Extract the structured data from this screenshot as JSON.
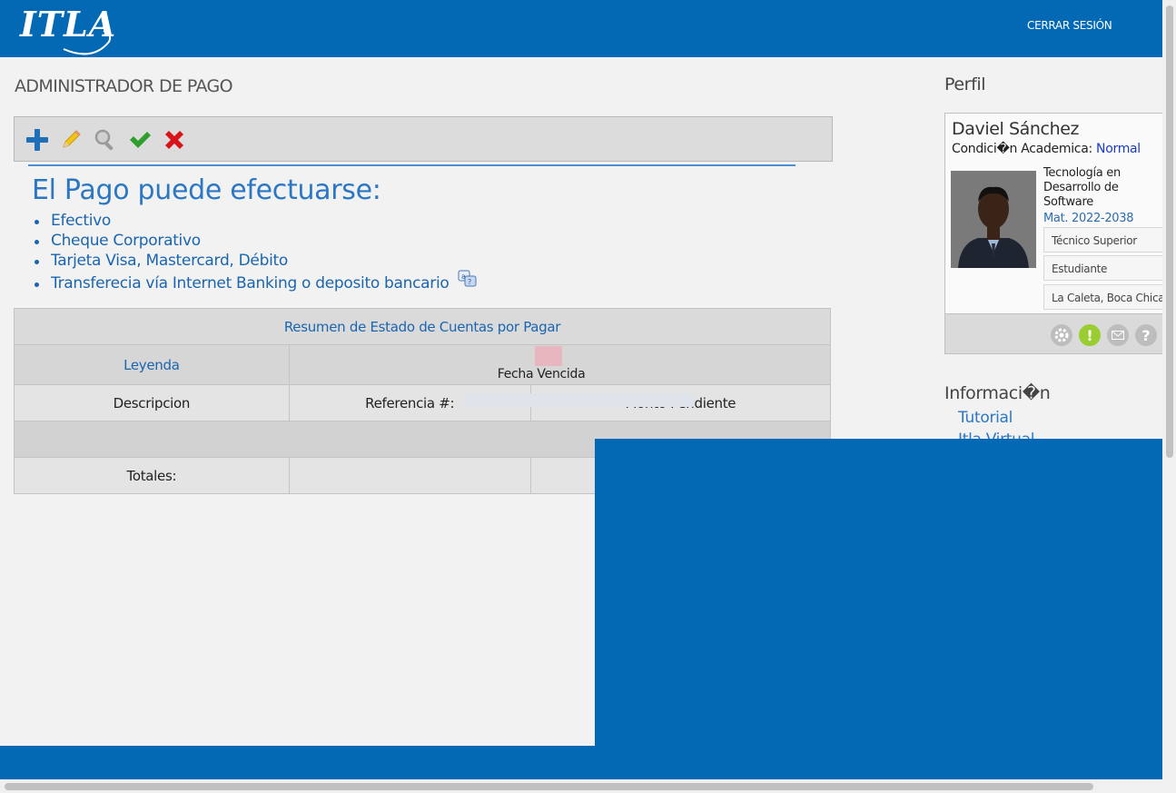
{
  "header": {
    "logo_text": "ITLA",
    "logout_label": "CERRAR SESIÓN"
  },
  "page": {
    "title": "ADMINISTRADOR DE PAGO"
  },
  "toolbar": {
    "icons": [
      "add-icon",
      "edit-pencil-icon",
      "search-magnifier-icon",
      "approve-check-icon",
      "delete-x-icon"
    ]
  },
  "payment_info": {
    "heading": "El Pago puede efectuarse:",
    "methods": [
      "Efectivo",
      "Cheque Corporativo",
      "Tarjeta Visa, Mastercard, Débito",
      "Transferecia vía Internet Banking o deposito bancario"
    ]
  },
  "summary": {
    "title": "Resumen de Estado de Cuentas por Pagar",
    "legend_label": "Leyenda",
    "legend_overdue": "Fecha Vencida",
    "columns": [
      "Descripcion",
      "Referencia #:",
      "Monto Pendiente"
    ],
    "totals_label": "Totales:"
  },
  "profile": {
    "section_title": "Perfil",
    "name": "Daviel Sánchez",
    "condition_label": "Condici�n Academica:",
    "condition_value": "Normal",
    "career": "Tecnología en Desarrollo de Software",
    "matricula": "Mat. 2022-2038",
    "level": "Técnico Superior",
    "role": "Estudiante",
    "location": "La Caleta, Boca Chica",
    "footer_icons": [
      "settings-gear-icon",
      "alert-icon",
      "mail-icon",
      "help-icon"
    ]
  },
  "information": {
    "section_title": "Informaci�n",
    "links": [
      "Tutorial",
      "Itla Virtual"
    ]
  },
  "colors": {
    "brand_blue": "#0369b5",
    "link_blue": "#2b77c4",
    "overdue_swatch": "#e8b6bf",
    "alert_green": "#9acd32"
  }
}
